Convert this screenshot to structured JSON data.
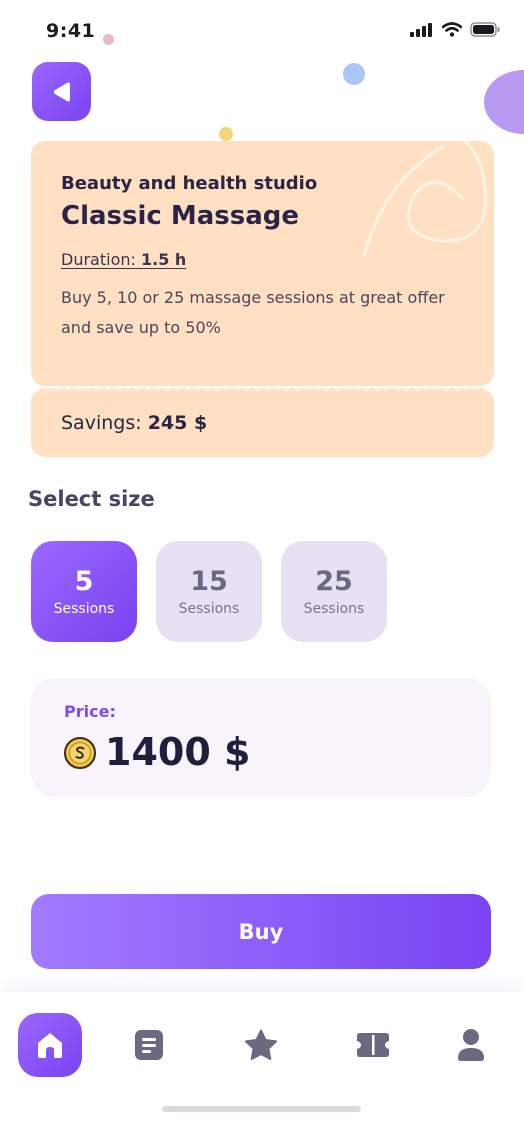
{
  "status_bar": {
    "time": "9:41",
    "icons": [
      "signal-icon",
      "wifi-icon",
      "battery-icon"
    ]
  },
  "nav": {
    "back_icon": "back-arrow-icon"
  },
  "offer": {
    "studio": "Beauty and health studio",
    "service": "Classic Massage",
    "duration_label": "Duration:",
    "duration_value": "1.5 h",
    "description": "Buy 5, 10 or 25 massage sessions at great offer and save up to 50%",
    "savings_label": "Savings:",
    "savings_value": "245 $"
  },
  "sizes": {
    "title": "Select size",
    "options": [
      {
        "number": "5",
        "label": "Sessions",
        "selected": true
      },
      {
        "number": "15",
        "label": "Sessions",
        "selected": false
      },
      {
        "number": "25",
        "label": "Sessions",
        "selected": false
      }
    ]
  },
  "price": {
    "label": "Price:",
    "value": "1400 $",
    "icon": "coin-icon"
  },
  "actions": {
    "buy_label": "Buy"
  },
  "tabbar": {
    "items": [
      {
        "icon": "home-icon",
        "active": true
      },
      {
        "icon": "document-icon",
        "active": false
      },
      {
        "icon": "star-icon",
        "active": false
      },
      {
        "icon": "ticket-icon",
        "active": false
      },
      {
        "icon": "profile-icon",
        "active": false
      }
    ]
  },
  "colors": {
    "accent": "#7a43f0",
    "card": "#ffe0c2",
    "tile_inactive": "#e7e1f4",
    "price_card": "#f7f5fb"
  }
}
